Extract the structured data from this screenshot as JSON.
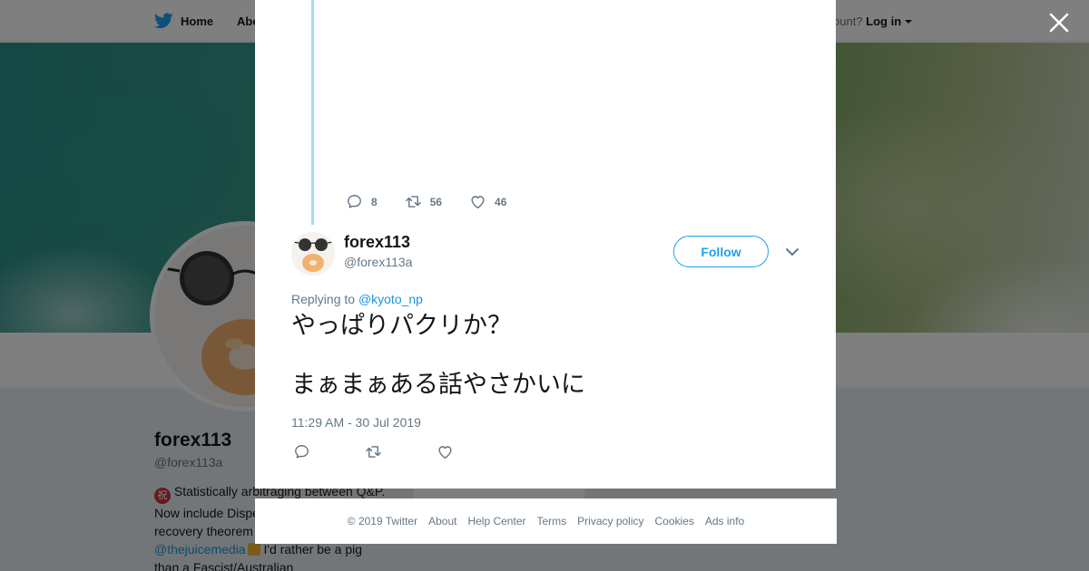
{
  "topbar": {
    "home_label": "Home",
    "about_label": "Abo",
    "account_text": "ccount?",
    "login_label": "Log in"
  },
  "profile": {
    "name": "forex113",
    "handle": "@forex113a",
    "bio_line1": " Statistically arbitraging between Q&P.",
    "bio_line2": "Now include Dispe",
    "bio_line3": "recovery theorem",
    "bio_mention": "@thejuicemedia",
    "bio_line4": " I'd rather be a pig",
    "bio_line5": "than a Fascist/Australian",
    "bio_emoji": "祝"
  },
  "side_card": {
    "label": "Ads info"
  },
  "previous_tweet": {
    "replies": "8",
    "retweets": "56",
    "likes": "46"
  },
  "tweet": {
    "author_name": "forex113",
    "author_handle": "@forex113a",
    "follow_label": "Follow",
    "replying_to_label": "Replying to",
    "replying_to_handle": "@kyoto_np",
    "text_line1": "やっぱりパクリか？",
    "text_line2": "まぁまぁある話やさかいに",
    "timestamp": "11:29 AM - 30 Jul 2019"
  },
  "footer": {
    "copyright": "© 2019 Twitter",
    "about": "About",
    "help": "Help Center",
    "terms": "Terms",
    "privacy": "Privacy policy",
    "cookies": "Cookies",
    "ads": "Ads info"
  },
  "colors": {
    "twitter_blue": "#1da1f2",
    "link_blue": "#1b95e0",
    "secondary_text": "#657786",
    "thread_line": "#a4d9f8"
  }
}
